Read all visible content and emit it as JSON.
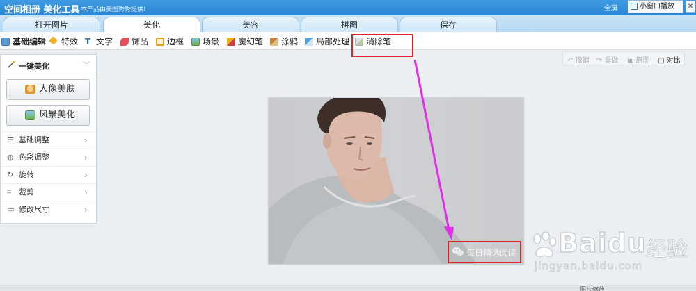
{
  "titlebar": {
    "app_name": "空间相册 美化工具",
    "subtitle": "本产品由美图秀秀提供!",
    "fullscreen_label": "全屏",
    "mini_window_label": "小窗口播放",
    "close_label": "✕"
  },
  "tabs": [
    {
      "label": "打开图片",
      "active": false
    },
    {
      "label": "美化",
      "active": true
    },
    {
      "label": "美容",
      "active": false
    },
    {
      "label": "拼图",
      "active": false
    },
    {
      "label": "保存",
      "active": false
    }
  ],
  "toolbar": {
    "items": [
      {
        "label": "基础编辑",
        "icon": "edit-icon",
        "active": true
      },
      {
        "label": "特效",
        "icon": "effects-icon",
        "active": false
      },
      {
        "label": "文字",
        "icon": "text-icon",
        "active": false
      },
      {
        "label": "饰品",
        "icon": "ornament-icon",
        "active": false
      },
      {
        "label": "边框",
        "icon": "frame-icon",
        "active": false
      },
      {
        "label": "场景",
        "icon": "scene-icon",
        "active": false
      },
      {
        "label": "魔幻笔",
        "icon": "magic-pen-icon",
        "active": false
      },
      {
        "label": "涂鸦",
        "icon": "doodle-icon",
        "active": false
      },
      {
        "label": "局部处理",
        "icon": "local-process-icon",
        "active": false
      },
      {
        "label": "消除笔",
        "icon": "eraser-pen-icon",
        "active": false
      }
    ]
  },
  "edit_actions": {
    "undo": "撤销",
    "redo": "重做",
    "original": "原图",
    "compare": "对比"
  },
  "left_panel": {
    "title": "一键美化",
    "portrait_button": "人像美肤",
    "landscape_button": "风景美化",
    "menu": [
      {
        "label": "基础调整",
        "icon": "adjust-icon"
      },
      {
        "label": "色彩调整",
        "icon": "palette-icon"
      },
      {
        "label": "旋转",
        "icon": "rotate-icon"
      },
      {
        "label": "裁剪",
        "icon": "crop-icon"
      },
      {
        "label": "修改尺寸",
        "icon": "resize-icon"
      }
    ]
  },
  "canvas": {
    "watermark_text": "每日精选阅读"
  },
  "baidu": {
    "logo_text": "Baidu",
    "logo_cn": "经验",
    "url": "jingyan.baidu.com"
  },
  "bottom": {
    "label": "图片缩放"
  },
  "colors": {
    "titlebar": "#2b86d4",
    "annotation_red": "#d8282c",
    "arrow_magenta": "#e22ee8"
  }
}
